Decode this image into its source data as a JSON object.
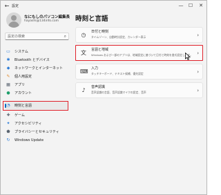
{
  "window": {
    "title": "設定",
    "back_icon": "back-arrow-icon"
  },
  "profile": {
    "name": "なにもしのパソコン編集長",
    "email": "hayashi@134info.com"
  },
  "search": {
    "placeholder": "設定の検索"
  },
  "sidebar": {
    "items": [
      {
        "label": "システム",
        "icon": "monitor-icon",
        "selected": false
      },
      {
        "label": "Bluetooth とデバイス",
        "icon": "bluetooth-icon",
        "selected": false
      },
      {
        "label": "ネットワークとインターネット",
        "icon": "wifi-icon",
        "selected": false
      },
      {
        "label": "個人用設定",
        "icon": "paintbrush-icon",
        "selected": false
      },
      {
        "label": "アプリ",
        "icon": "apps-icon",
        "selected": false
      },
      {
        "label": "アカウント",
        "icon": "person-icon",
        "selected": false
      },
      {
        "label": "時刻と言語",
        "icon": "globe-clock-icon",
        "selected": true
      },
      {
        "label": "ゲーム",
        "icon": "gamepad-icon",
        "selected": false
      },
      {
        "label": "アクセシビリティ",
        "icon": "accessibility-icon",
        "selected": false
      },
      {
        "label": "プライバシーとセキュリティ",
        "icon": "shield-icon",
        "selected": false
      },
      {
        "label": "Windows Update",
        "icon": "update-icon",
        "selected": false
      }
    ]
  },
  "main": {
    "title": "時刻と言語",
    "cards": [
      {
        "title": "日付と時刻",
        "desc": "タイムゾーン、自動時計設定、カレンダー表示",
        "icon": "clock-icon"
      },
      {
        "title": "言語と地域",
        "desc": "Windows および一部のアプリは、地域設定に基づいて日付と時刻を書式設定します。",
        "icon": "language-icon"
      },
      {
        "title": "入力",
        "desc": "タッチキーボード、テキスト候補、優先設定",
        "icon": "keyboard-icon"
      },
      {
        "title": "音声認識",
        "desc": "音声認識の言語、音声認識マイクの設定、音声",
        "icon": "microphone-icon"
      }
    ]
  },
  "colors": {
    "accent": "#0067c0",
    "highlight": "#e0212a"
  }
}
